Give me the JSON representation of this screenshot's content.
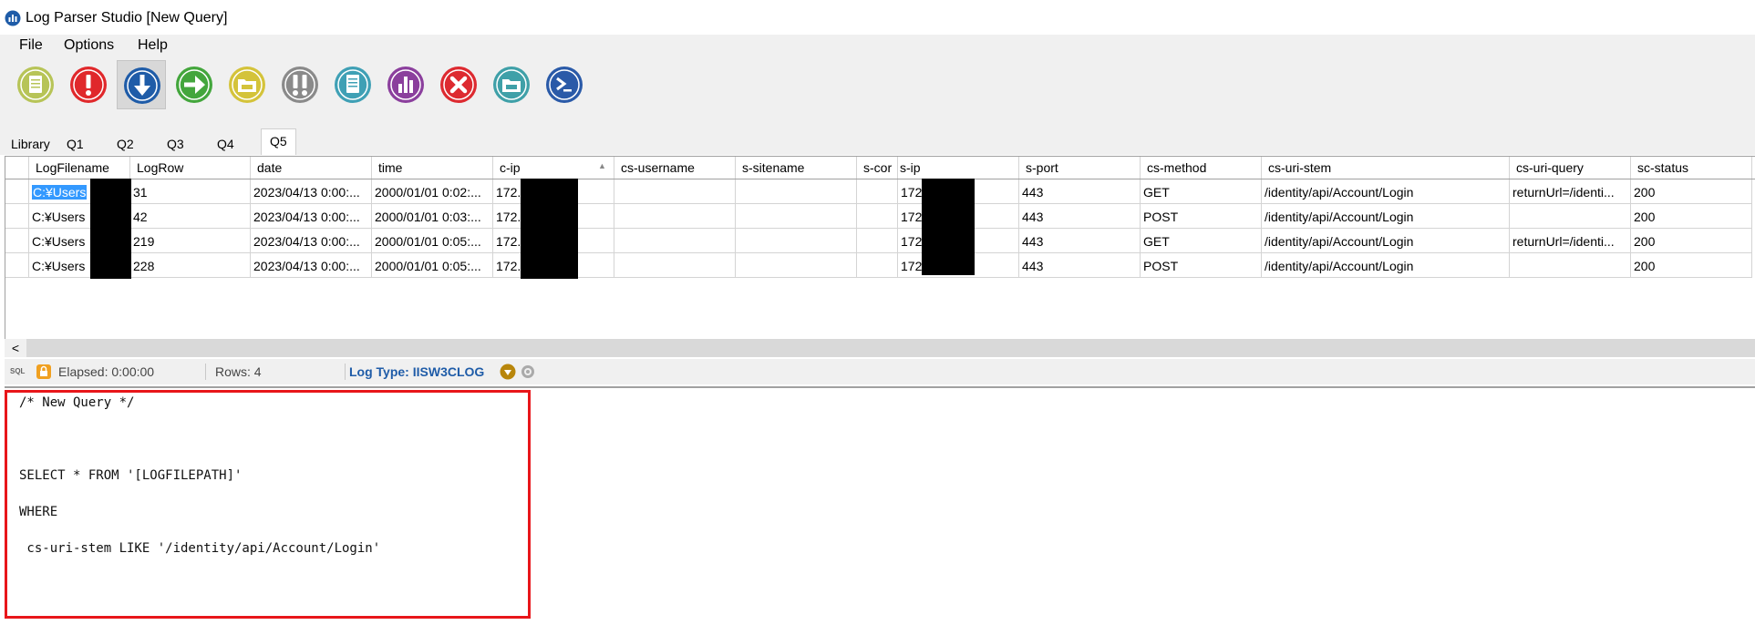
{
  "window": {
    "title": "Log Parser Studio  [New Query]"
  },
  "menu": {
    "items": [
      "File",
      "Options",
      "Help"
    ]
  },
  "toolbar": {
    "buttons": [
      {
        "name": "new-query-icon",
        "color": "#b7c457"
      },
      {
        "name": "execute-icon",
        "color": "#e0282b"
      },
      {
        "name": "download-icon",
        "color": "#1f5ca8"
      },
      {
        "name": "arrow-right-icon",
        "color": "#43a63c"
      },
      {
        "name": "open-folder-icon",
        "color": "#d4c33a"
      },
      {
        "name": "batch-execute-icon",
        "color": "#8a8a8a"
      },
      {
        "name": "document-icon",
        "color": "#3fa0b5"
      },
      {
        "name": "chart-icon",
        "color": "#8b3f9d"
      },
      {
        "name": "cancel-icon",
        "color": "#dd2a30"
      },
      {
        "name": "export-csv-icon",
        "color": "#3fa0a8"
      },
      {
        "name": "powershell-icon",
        "color": "#2a5aa8"
      }
    ]
  },
  "tabs": [
    "Library",
    "Q1",
    "Q2",
    "Q3",
    "Q4",
    "Q5"
  ],
  "active_tab": "Q5",
  "grid": {
    "columns": [
      "LogFilename",
      "LogRow",
      "date",
      "time",
      "c-ip",
      "cs-username",
      "s-sitename",
      "s-cor",
      "s-ip",
      "s-port",
      "cs-method",
      "cs-uri-stem",
      "cs-uri-query",
      "sc-status"
    ],
    "sort_indicator": "▲",
    "rows": [
      [
        "C:¥Users",
        "31",
        "2023/04/13 0:00:...",
        "2000/01/01 0:02:...",
        "172.",
        "",
        "",
        "",
        "172",
        "443",
        "GET",
        "/identity/api/Account/Login",
        "returnUrl=/identi...",
        "200"
      ],
      [
        "C:¥Users",
        "42",
        "2023/04/13 0:00:...",
        "2000/01/01 0:03:...",
        "172.",
        "",
        "",
        "",
        "172",
        "443",
        "POST",
        "/identity/api/Account/Login",
        "",
        "200"
      ],
      [
        "C:¥Users",
        "219",
        "2023/04/13 0:00:...",
        "2000/01/01 0:05:...",
        "172.",
        "",
        "",
        "",
        "172",
        "443",
        "GET",
        "/identity/api/Account/Login",
        "returnUrl=/identi...",
        "200"
      ],
      [
        "C:¥Users",
        "228",
        "2023/04/13 0:00:...",
        "2000/01/01 0:05:...",
        "172.",
        "",
        "",
        "",
        "172",
        "443",
        "POST",
        "/identity/api/Account/Login",
        "",
        "200"
      ]
    ]
  },
  "scroll": {
    "left_arrow": "<"
  },
  "status": {
    "elapsed": "Elapsed: 0:00:00",
    "rows": "Rows: 4",
    "log_type": "Log Type: IISW3CLOG"
  },
  "query": {
    "lines": [
      "/* New Query */",
      "",
      "",
      "SELECT * FROM '[LOGFILEPATH]'",
      "",
      "WHERE",
      "",
      " cs-uri-stem LIKE '/identity/api/Account/Login'"
    ]
  }
}
